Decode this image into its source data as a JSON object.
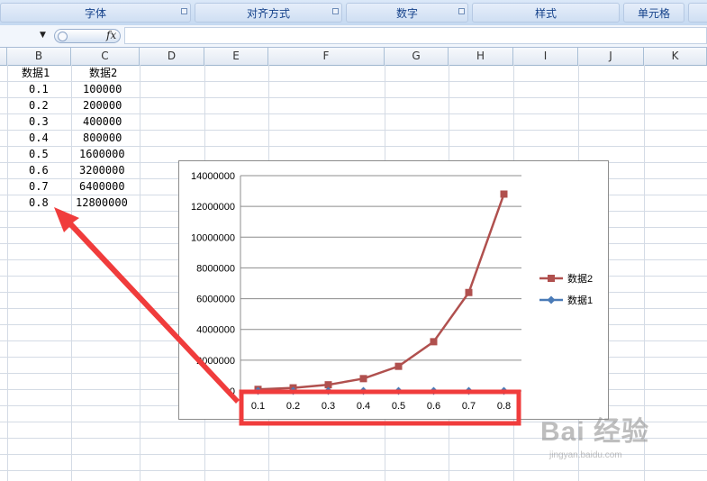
{
  "ribbon": {
    "groups": [
      {
        "label": "字体"
      },
      {
        "label": "对齐方式"
      },
      {
        "label": "数字"
      },
      {
        "label": "样式"
      },
      {
        "label": "单元格"
      }
    ]
  },
  "formula_bar": {
    "fx_label": "fx",
    "dropdown_glyph": "▼",
    "formula": ""
  },
  "columns": [
    "B",
    "C",
    "D",
    "E",
    "F",
    "G",
    "H",
    "I",
    "J",
    "K"
  ],
  "sheet": {
    "headers": [
      "数据1",
      "数据2"
    ],
    "rows": [
      [
        "0.1",
        "100000"
      ],
      [
        "0.2",
        "200000"
      ],
      [
        "0.3",
        "400000"
      ],
      [
        "0.4",
        "800000"
      ],
      [
        "0.5",
        "1600000"
      ],
      [
        "0.6",
        "3200000"
      ],
      [
        "0.7",
        "6400000"
      ],
      [
        "0.8",
        "12800000"
      ]
    ]
  },
  "chart_data": {
    "type": "line",
    "categories": [
      "0.1",
      "0.2",
      "0.3",
      "0.4",
      "0.5",
      "0.6",
      "0.7",
      "0.8"
    ],
    "series": [
      {
        "name": "数据2",
        "values": [
          100000,
          200000,
          400000,
          800000,
          1600000,
          3200000,
          6400000,
          12800000
        ],
        "color": "#b0504e",
        "marker": "square"
      },
      {
        "name": "数据1",
        "values": [
          0.1,
          0.2,
          0.3,
          0.4,
          0.5,
          0.6,
          0.7,
          0.8
        ],
        "color": "#4a7bb7",
        "marker": "diamond"
      }
    ],
    "ylim": [
      0,
      14000000
    ],
    "yticks": [
      "0",
      "2000000",
      "4000000",
      "6000000",
      "8000000",
      "10000000",
      "12000000",
      "14000000"
    ],
    "grid": true,
    "legend": "right"
  },
  "annotation": {
    "highlight_color": "#f03c3c"
  },
  "watermark": {
    "logo": "Bai  经验",
    "site": "jingyan.baidu.com"
  }
}
